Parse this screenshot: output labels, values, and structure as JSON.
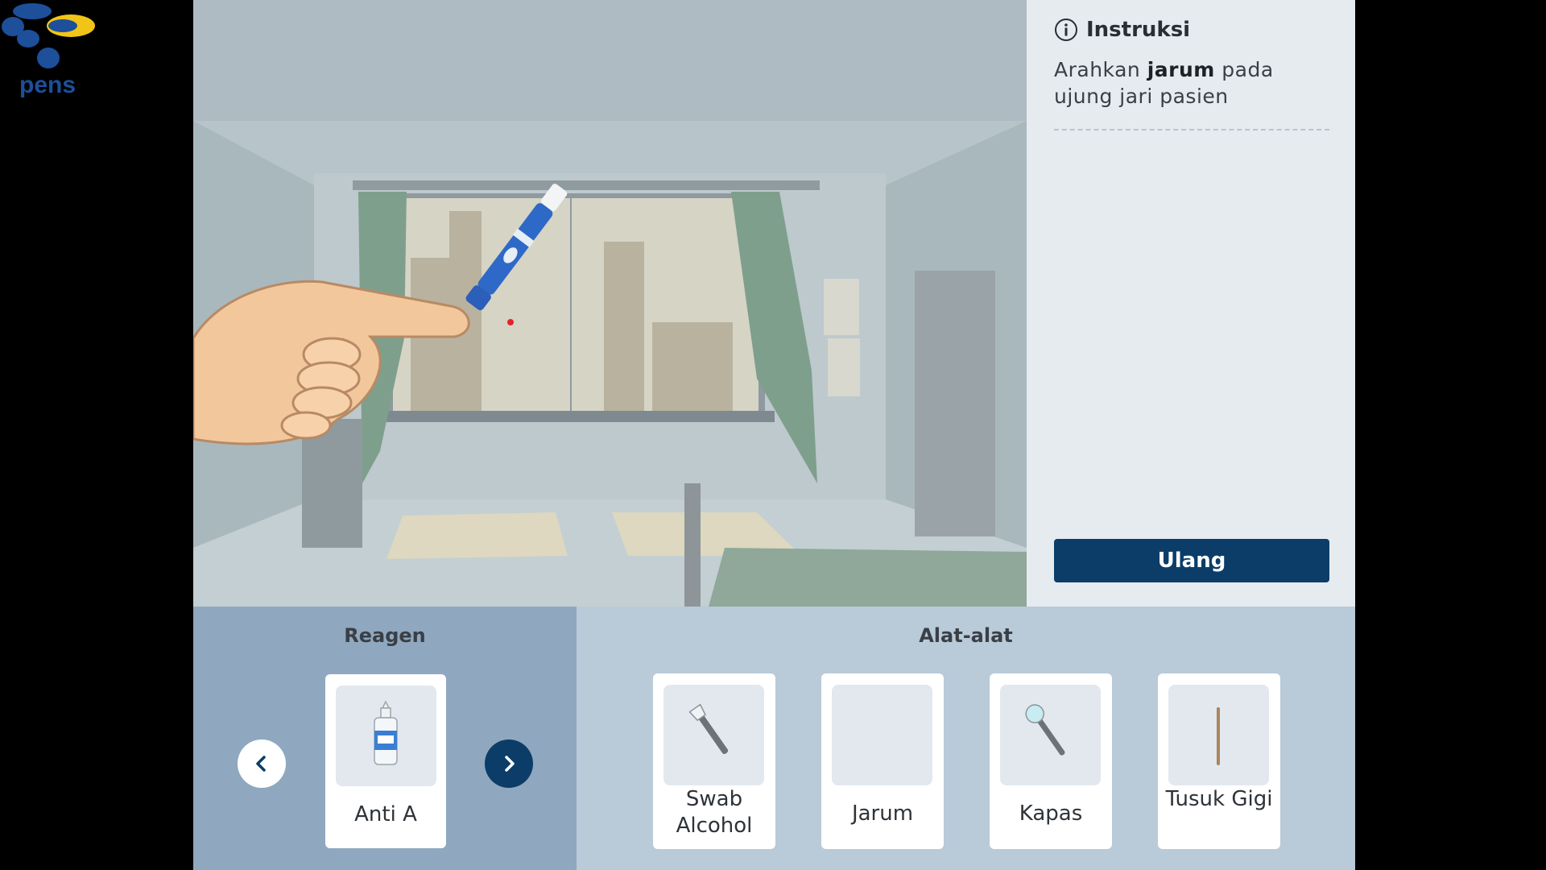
{
  "logo": {
    "text": "pens",
    "icon": "pens-logo"
  },
  "scene": {
    "icons": [
      "hand-pointing",
      "lancet-pen",
      "blood-drop"
    ]
  },
  "instructions": {
    "title": "Instruksi",
    "icon": "info-icon",
    "text_before": "Arahkan",
    "text_bold": "jarum",
    "text_after": "pada ujung jari pasien",
    "reset_label": "Ulang"
  },
  "reagen": {
    "title": "Reagen",
    "items": [
      {
        "label": "Anti A",
        "icon": "reagent-bottle-icon"
      }
    ],
    "prev_icon": "chevron-left-icon",
    "next_icon": "chevron-right-icon"
  },
  "tools": {
    "title": "Alat-alat",
    "items": [
      {
        "label": "Swab Alcohol",
        "icon": "swab-icon"
      },
      {
        "label": "Jarum",
        "icon": "empty"
      },
      {
        "label": "Kapas",
        "icon": "cotton-swab-icon"
      },
      {
        "label": "Tusuk Gigi",
        "icon": "toothpick-icon"
      }
    ]
  },
  "colors": {
    "primary": "#0b3d68",
    "panel": "#e6ebf0",
    "reagen_bg": "#8fa8bf",
    "tools_bg": "#b9cad8"
  }
}
